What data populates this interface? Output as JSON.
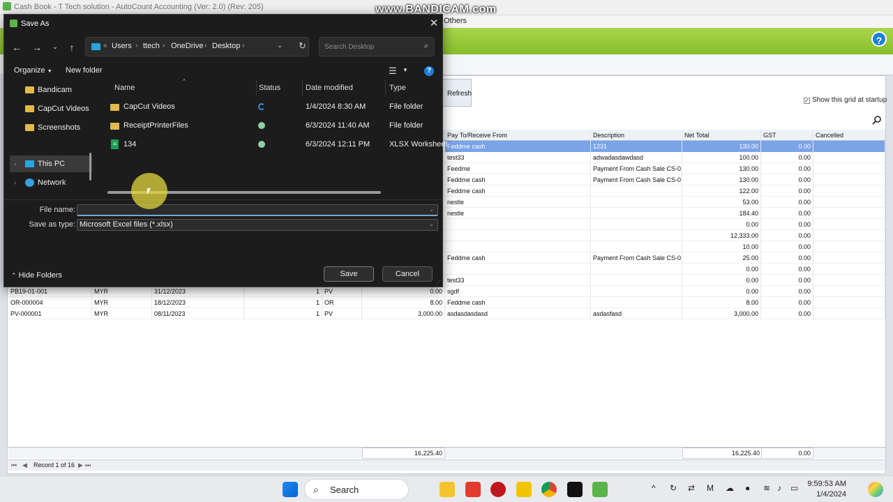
{
  "app": {
    "title": "Cash Book - T Tech solution - AutoCount Accounting (Ver: 2.0) (Rev: 205)",
    "menu_others": "Others",
    "refresh_label": "Refresh",
    "show_grid_label": "Show this grid at startup",
    "watermark": "www.BANDICAM.com",
    "help": "?"
  },
  "grid": {
    "columns": [
      "Pay To/Receive From",
      "Description",
      "Net Total",
      "GST",
      "Cancelled"
    ],
    "rows": [
      {
        "doc": "",
        "cur": "",
        "date": "",
        "n": "",
        "t": "",
        "amt": "",
        "pay": "Feddme cash",
        "desc": "1231",
        "net": "130.00",
        "gst": "0.00",
        "sel": true
      },
      {
        "doc": "",
        "cur": "",
        "date": "",
        "n": "",
        "t": "",
        "amt": "",
        "pay": "test33",
        "desc": "adwadasdawdasd",
        "net": "100.00",
        "gst": "0.00"
      },
      {
        "doc": "",
        "cur": "",
        "date": "",
        "n": "",
        "t": "",
        "amt": "",
        "pay": "Feedme",
        "desc": "Payment From Cash Sale CS-0...",
        "net": "130.00",
        "gst": "0.00"
      },
      {
        "doc": "",
        "cur": "",
        "date": "",
        "n": "",
        "t": "",
        "amt": "",
        "pay": "Feddme cash",
        "desc": "Payment From Cash Sale CS-0...",
        "net": "130.00",
        "gst": "0.00"
      },
      {
        "doc": "",
        "cur": "",
        "date": "",
        "n": "",
        "t": "",
        "amt": "",
        "pay": "Feddme cash",
        "desc": "",
        "net": "122.00",
        "gst": "0.00"
      },
      {
        "doc": "",
        "cur": "",
        "date": "",
        "n": "",
        "t": "",
        "amt": "",
        "pay": "nestle",
        "desc": "",
        "net": "53.00",
        "gst": "0.00"
      },
      {
        "doc": "",
        "cur": "",
        "date": "",
        "n": "",
        "t": "",
        "amt": "",
        "pay": "nestle",
        "desc": "",
        "net": "184.40",
        "gst": "0.00"
      },
      {
        "doc": "",
        "cur": "",
        "date": "",
        "n": "",
        "t": "",
        "amt": "",
        "pay": "",
        "desc": "",
        "net": "0.00",
        "gst": "0.00"
      },
      {
        "doc": "",
        "cur": "",
        "date": "",
        "n": "",
        "t": "",
        "amt": "",
        "pay": "",
        "desc": "",
        "net": "12,333.00",
        "gst": "0.00"
      },
      {
        "doc": "",
        "cur": "",
        "date": "",
        "n": "",
        "t": "",
        "amt": "",
        "pay": "",
        "desc": "",
        "net": "10.00",
        "gst": "0.00"
      },
      {
        "doc": "",
        "cur": "",
        "date": "",
        "n": "",
        "t": "",
        "amt": "",
        "pay": "Feddme cash",
        "desc": "Payment From Cash Sale CS-0...",
        "net": "25.00",
        "gst": "0.00"
      },
      {
        "doc": "",
        "cur": "",
        "date": "",
        "n": "",
        "t": "",
        "amt": "",
        "pay": "",
        "desc": "",
        "net": "0.00",
        "gst": "0.00"
      },
      {
        "doc": "",
        "cur": "",
        "date": "",
        "n": "",
        "t": "",
        "amt": "",
        "pay": "test33",
        "desc": "",
        "net": "0.00",
        "gst": "0.00"
      },
      {
        "doc": "PB19-01-001",
        "cur": "MYR",
        "date": "31/12/2023",
        "n": "1",
        "t": "PV",
        "amt": "0.00",
        "pay": "sgdf",
        "desc": "",
        "net": "0.00",
        "gst": "0.00"
      },
      {
        "doc": "OR-000004",
        "cur": "MYR",
        "date": "18/12/2023",
        "n": "1",
        "t": "OR",
        "amt": "8.00",
        "pay": "Feddme cash",
        "desc": "",
        "net": "8.00",
        "gst": "0.00"
      },
      {
        "doc": "PV-000001",
        "cur": "MYR",
        "date": "08/11/2023",
        "n": "1",
        "t": "PV",
        "amt": "3,000.00",
        "pay": "asdasdasdasd",
        "desc": "asdasfasd",
        "net": "3,000.00",
        "gst": "0.00"
      }
    ],
    "footer_amount": "16,225.40",
    "footer_net": "16,225.40",
    "footer_gst": "0.00",
    "record_label": "Record 1 of 16"
  },
  "dialog": {
    "title": "Save As",
    "path": [
      "Users",
      "ttech",
      "OneDrive",
      "Desktop"
    ],
    "search_placeholder": "Search Desktop",
    "organize": "Organize",
    "new_folder": "New folder",
    "nav": [
      {
        "label": "Bandicam",
        "kind": "folder"
      },
      {
        "label": "CapCut Videos",
        "kind": "folder"
      },
      {
        "label": "Screenshots",
        "kind": "folder"
      },
      {
        "label": "This PC",
        "kind": "pc"
      },
      {
        "label": "Network",
        "kind": "net"
      }
    ],
    "columns": {
      "name": "Name",
      "status": "Status",
      "date": "Date modified",
      "type": "Type"
    },
    "files": [
      {
        "name": "CapCut Videos",
        "date": "1/4/2024 8:30 AM",
        "type": "File folder",
        "status": "sync"
      },
      {
        "name": "ReceiptPrinterFiles",
        "date": "6/3/2024 11:40 AM",
        "type": "File folder",
        "status": "ok"
      },
      {
        "name": "134",
        "date": "6/3/2024 12:11 PM",
        "type": "XLSX Worksheet",
        "status": "ok"
      }
    ],
    "file_name_label": "File name:",
    "file_name_value": "",
    "save_type_label": "Save as type:",
    "save_type_value": "Microsoft Excel files (*.xlsx)",
    "hide_folders": "Hide Folders",
    "save": "Save",
    "cancel": "Cancel"
  },
  "taskbar": {
    "search": "Search",
    "time": "9:59:53 AM",
    "date": "1/4/2024"
  },
  "colors": {
    "accent": "#1e7fd8",
    "green_band": "#96c935",
    "selected_row": "#7aa3e8"
  }
}
